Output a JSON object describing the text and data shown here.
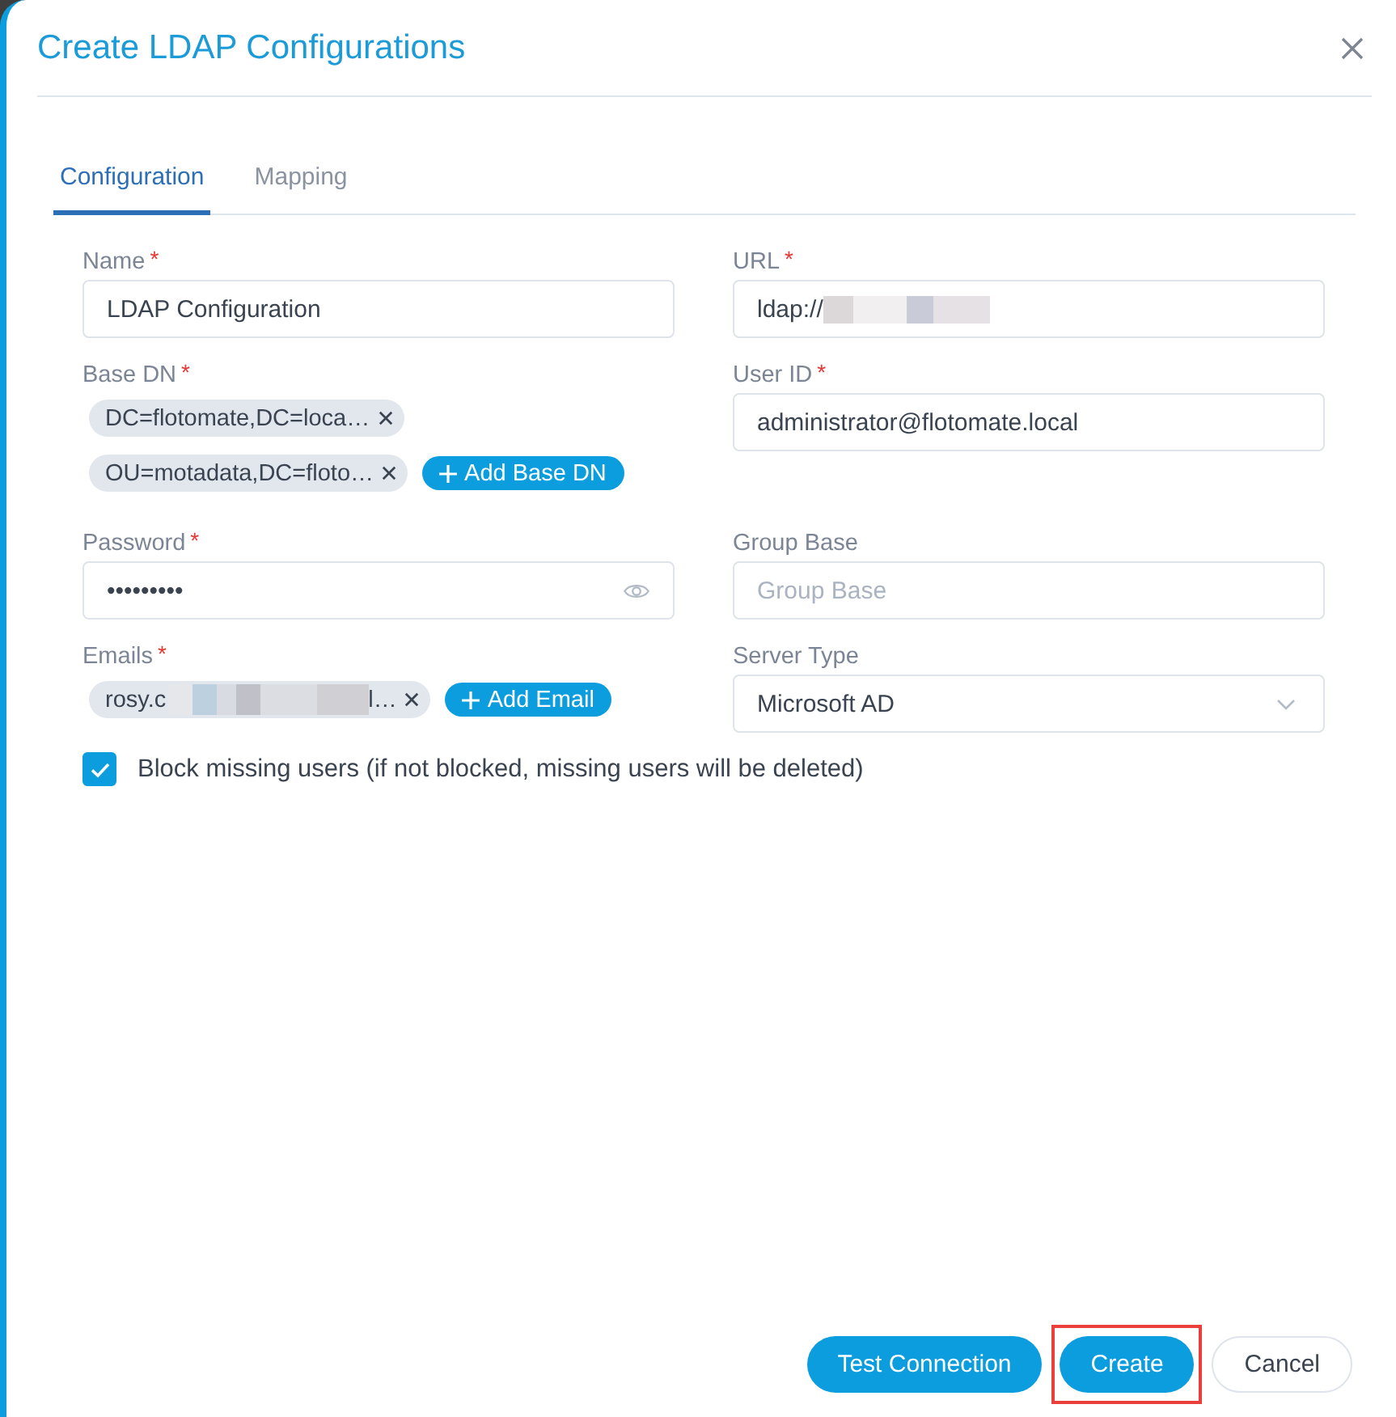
{
  "dialog": {
    "title": "Create LDAP Configurations"
  },
  "tabs": [
    {
      "label": "Configuration",
      "selected": true
    },
    {
      "label": "Mapping",
      "selected": false
    }
  ],
  "fields": [
    {
      "kind": "text",
      "label": "Name",
      "required_mark": "*",
      "value": "LDAP Configuration"
    },
    {
      "kind": "text",
      "label": "URL",
      "required_mark": "*",
      "value": "ldap://",
      "redacted": true
    },
    {
      "kind": "chips",
      "label": "Base DN",
      "required_mark": "*",
      "chips": [
        {
          "text": "DC=flotomate,DC=loca…",
          "redacted": false
        },
        {
          "text": "OU=motadata,DC=floto…",
          "redacted": false
        }
      ],
      "add_label": "Add Base DN"
    },
    {
      "kind": "text",
      "label": "User ID",
      "required_mark": "*",
      "value": "administrator@flotomate.local"
    },
    {
      "kind": "password",
      "label": "Password",
      "required_mark": "*",
      "value": "•••••••••"
    },
    {
      "kind": "text",
      "label": "Group Base",
      "placeholder": "Group Base"
    },
    {
      "kind": "chips",
      "label": "Emails",
      "required_mark": "*",
      "chips": [
        {
          "text": "rosy.c",
          "redacted": true,
          "tail": "l…"
        }
      ],
      "add_label": "Add Email"
    },
    {
      "kind": "select",
      "label": "Server Type",
      "value": "Microsoft AD"
    }
  ],
  "options": [
    {
      "label": "Block missing users (if not blocked, missing users will be deleted)",
      "checked": true
    }
  ],
  "footer": {
    "buttons": [
      {
        "label": "Test Connection",
        "kind": "primary",
        "highlighted": false
      },
      {
        "label": "Create",
        "kind": "primary",
        "highlighted": true
      },
      {
        "label": "Cancel",
        "kind": "secondary",
        "highlighted": false
      }
    ]
  }
}
